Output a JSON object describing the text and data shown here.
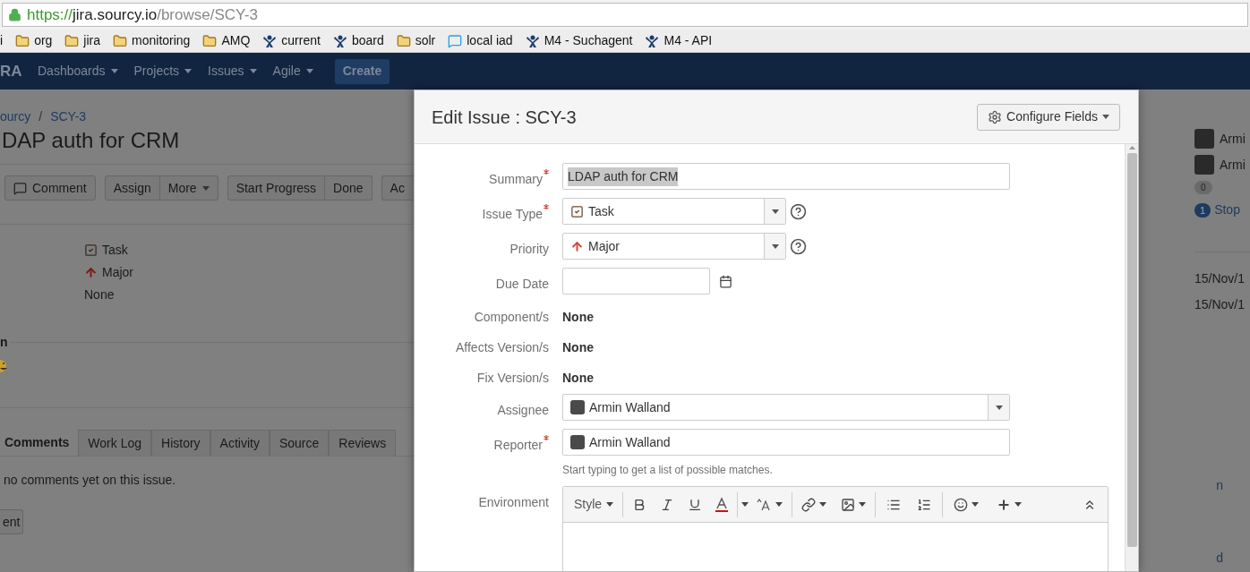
{
  "browser": {
    "url": {
      "scheme": "https://",
      "host": "jira.sourcy.io",
      "path": "/browse/SCY-3"
    },
    "bookmarks": [
      {
        "kind": "plain",
        "label": "i"
      },
      {
        "kind": "folder",
        "label": "org"
      },
      {
        "kind": "folder",
        "label": "jira"
      },
      {
        "kind": "folder",
        "label": "monitoring"
      },
      {
        "kind": "folder",
        "label": "AMQ"
      },
      {
        "kind": "jira",
        "label": "current"
      },
      {
        "kind": "jira",
        "label": "board"
      },
      {
        "kind": "folder",
        "label": "solr"
      },
      {
        "kind": "chat",
        "label": "local iad"
      },
      {
        "kind": "jira",
        "label": "M4 - Suchagent"
      },
      {
        "kind": "jira",
        "label": "M4 - API"
      }
    ]
  },
  "header": {
    "logo": "RA",
    "nav": [
      "Dashboards",
      "Projects",
      "Issues",
      "Agile"
    ],
    "create": "Create"
  },
  "issue": {
    "breadcrumb": {
      "project": "ourcy",
      "separator": "/",
      "key": "SCY-3"
    },
    "title": "DAP auth for CRM",
    "action_groups": [
      [
        {
          "kind": "comment",
          "label": "Comment"
        }
      ],
      [
        {
          "kind": "plain",
          "label": "Assign"
        },
        {
          "kind": "menu",
          "label": "More"
        }
      ],
      [
        {
          "kind": "plain",
          "label": "Start Progress"
        },
        {
          "kind": "plain",
          "label": "Done"
        }
      ],
      [
        {
          "kind": "plain",
          "label": "Ac"
        }
      ]
    ],
    "details": [
      {
        "kind": "task",
        "text": "Task"
      },
      {
        "kind": "priority",
        "text": "Major"
      },
      {
        "kind": "plain",
        "text": "None"
      }
    ],
    "section_heading": "n",
    "tabs": [
      {
        "label": "Comments",
        "selected": true
      },
      {
        "label": "Work Log",
        "selected": false
      },
      {
        "label": "History",
        "selected": false
      },
      {
        "label": "Activity",
        "selected": false
      },
      {
        "label": "Source",
        "selected": false
      },
      {
        "label": "Reviews",
        "selected": false
      }
    ],
    "empty_message": "no comments yet on this issue.",
    "comment_button": "ent"
  },
  "people": {
    "users": [
      "Armi",
      "Armi"
    ],
    "votes": "0",
    "watchers": "1",
    "watch_link": "Stop"
  },
  "dates": [
    "15/Nov/1",
    "15/Nov/1"
  ],
  "links": [
    "n",
    "d"
  ],
  "dialog": {
    "title": "Edit Issue : SCY-3",
    "configure": "Configure Fields",
    "fields": [
      {
        "kind": "text",
        "label": "Summary",
        "required": true,
        "value": "LDAP auth for CRM",
        "value_selected": true
      },
      {
        "kind": "select",
        "label": "Issue Type",
        "required": true,
        "value": "Task",
        "help": true
      },
      {
        "kind": "select",
        "label": "Priority",
        "required": false,
        "value": "Major",
        "help": true
      },
      {
        "kind": "date",
        "label": "Due Date",
        "required": false
      },
      {
        "kind": "static",
        "label": "Component/s",
        "required": false,
        "value": "None"
      },
      {
        "kind": "static",
        "label": "Affects Version/s",
        "required": false,
        "value": "None"
      },
      {
        "kind": "static",
        "label": "Fix Version/s",
        "required": false,
        "value": "None"
      },
      {
        "kind": "user-select",
        "label": "Assignee",
        "required": false,
        "value": "Armin Walland"
      },
      {
        "kind": "user",
        "label": "Reporter",
        "required": true,
        "value": "Armin Walland",
        "hint": "Start typing to get a list of possible matches."
      },
      {
        "kind": "editor",
        "label": "Environment",
        "required": false,
        "toolbar_label": "Style"
      }
    ]
  }
}
